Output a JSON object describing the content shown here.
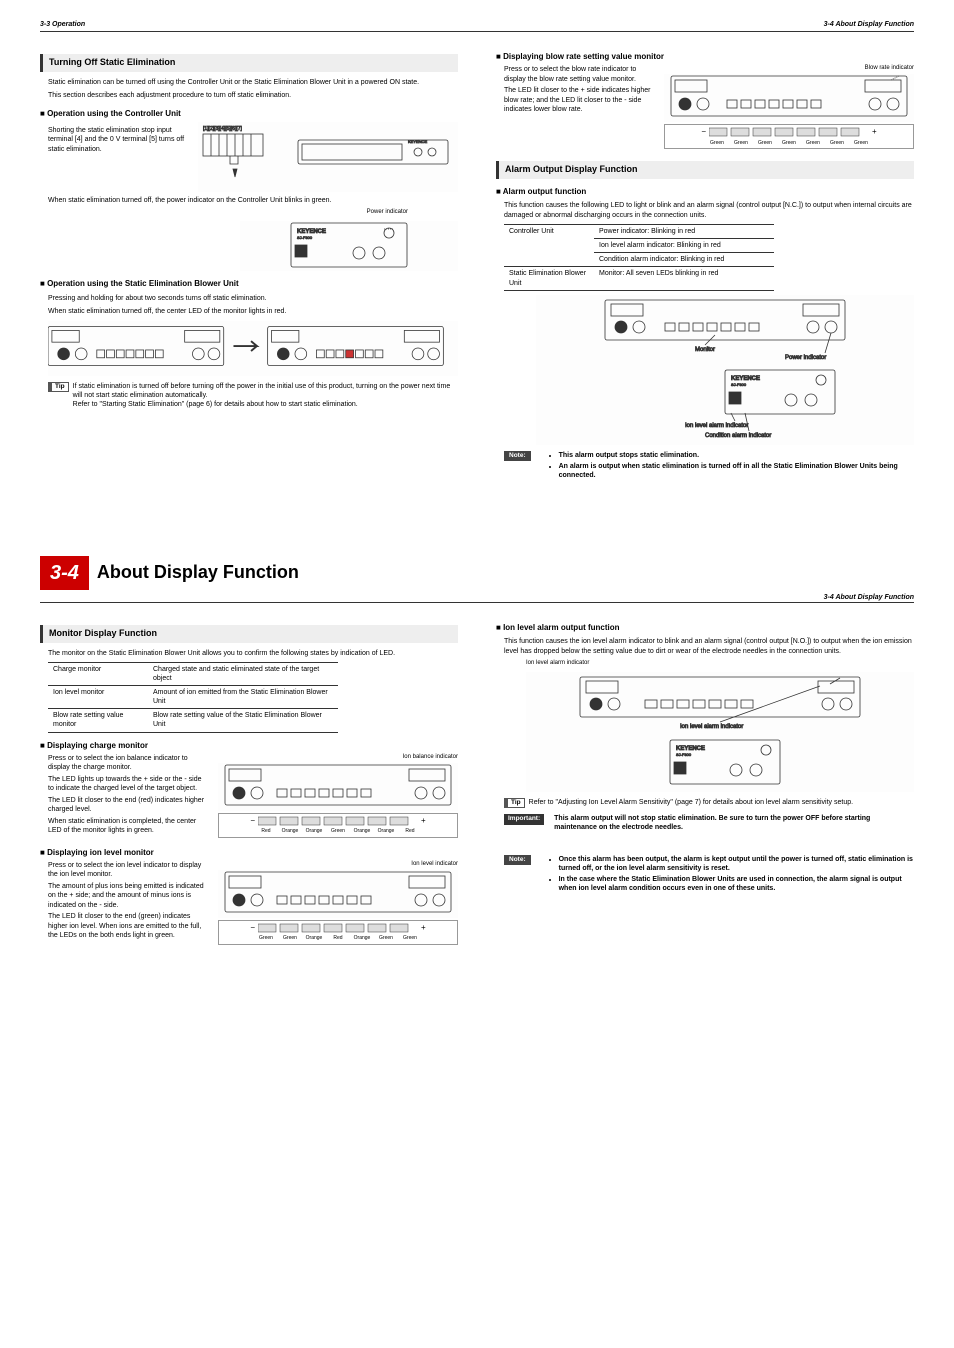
{
  "header": {
    "left": "3-3  Operation",
    "right": "3-4  About Display Function"
  },
  "left": {
    "sec1_title": "Turning Off Static Elimination",
    "sec1_p1": "Static elimination can be turned off using the Controller Unit or the Static Elimination Blower Unit in a powered ON state.",
    "sec1_p2": "This section describes each adjustment procedure to turn off static elimination.",
    "sub1": "Operation using the Controller Unit",
    "sub1_p1": "Shorting the static elimination stop input terminal [4] and the 0 V terminal [5] turns off static elimination.",
    "sub1_p2": "When static elimination turned off, the power indicator on the Controller Unit blinks in green.",
    "sub1_cap1": "Power indicator",
    "sub2": "Operation using the Static Elimination Blower Unit",
    "sub2_p1": "Pressing and holding       for about two seconds turns off static elimination.",
    "sub2_p2": "When static elimination turned off, the center LED of the monitor lights in red.",
    "tip1": "If static elimination is turned off before turning off the power in the initial use of this product, turning on the power next time will not start static elimination automatically.",
    "tip1_ref": "Refer to      \"Starting Static Elimination\" (page 6) for details about how to start static elimination."
  },
  "right": {
    "sub_blow": "Displaying blow rate setting value monitor",
    "blow_p1": "Press       or       to select the blow rate indicator to display the blow rate setting value monitor.",
    "blow_p2": "The LED lit closer to the + side indicates higher blow rate; and the LED lit closer to the - side indicates lower blow rate.",
    "blow_cap": "Blow rate indicator",
    "led_blow": [
      "Green",
      "Green",
      "Green",
      "Green",
      "Green",
      "Green",
      "Green"
    ],
    "sec2_title": "Alarm Output Display Function",
    "sub_alarm": "Alarm output function",
    "alarm_p1": "This function causes the following LED to light or blink and an alarm signal (control output [N.C.]) to output when internal circuits are damaged or abnormal discharging occurs in the connection units.",
    "table1": [
      [
        "Controller Unit",
        "Power indicator: Blinking in red"
      ],
      [
        "",
        "Ion level alarm indicator: Blinking in red"
      ],
      [
        "",
        "Condition alarm indicator: Blinking in red"
      ],
      [
        "Static Elimination Blower Unit",
        "Monitor: All seven LEDs blinking in red"
      ]
    ],
    "alarm_caps": {
      "mon": "Monitor",
      "pow": "Power indicator",
      "ion": "Ion level alarm indicator",
      "cond": "Condition alarm indicator"
    },
    "note1_b1": "This alarm output stops static elimination.",
    "note1_b2": "An alarm is output when static elimination is turned off in all the Static Elimination Blower Units being connected."
  },
  "ch": {
    "num": "3-4",
    "title": "About Display Function",
    "right": "3-4  About Display Function"
  },
  "left2": {
    "sec3_title": "Monitor Display Function",
    "sec3_p1": "The monitor on the Static Elimination Blower Unit allows you to confirm the following states by indication of LED.",
    "t2": [
      [
        "Charge monitor",
        "Charged state and static eliminated state of the target object"
      ],
      [
        "Ion level monitor",
        "Amount of ion emitted from the Static Elimination Blower Unit"
      ],
      [
        "Blow rate setting value monitor",
        "Blow rate setting value of the Static Elimination Blower Unit"
      ]
    ],
    "sub_charge": "Displaying charge monitor",
    "charge_p1": "Press       or       to select the ion balance indicator to display the charge monitor.",
    "charge_p2": "The LED lights up towards the + side or the - side to indicate the charged level of the target object.",
    "charge_p3": "The LED lit closer to the end (red) indicates higher charged level.",
    "charge_p4": "When static elimination is completed, the center LED of the monitor lights in green.",
    "charge_cap": "Ion balance indicator",
    "led_charge": [
      "Red",
      "Orange",
      "Orange",
      "Green",
      "Orange",
      "Orange",
      "Red"
    ],
    "sub_ion": "Displaying ion level monitor",
    "ion_p1": "Press       or       to select the ion level indicator to display the ion level monitor.",
    "ion_p2": "The amount of plus ions being emitted is indicated on the + side; and the amount of minus ions is indicated on the - side.",
    "ion_p3": "The LED lit closer to the end (green) indicates higher ion level. When ions are emitted to the full, the LEDs on the both ends light in green.",
    "ion_cap": "Ion level indicator",
    "led_ion": [
      "Green",
      "Green",
      "Orange",
      "Red",
      "Orange",
      "Green",
      "Green"
    ]
  },
  "right2": {
    "sub_ionalarm": "Ion level alarm output function",
    "ia_p1": "This function causes the ion level alarm indicator to blink and an alarm signal (control output [N.O.]) to output when the ion emission level has dropped below the setting value due to dirt or wear of the electrode needles in the connection units.",
    "ia_cap1": "Ion level alarm indicator",
    "ia_cap2": "Ion level alarm indicator",
    "tip2": "Refer to      \"Adjusting Ion Level Alarm Sensitivity\" (page 7) for details about ion level alarm sensitivity setup.",
    "imp": "This alarm output will not stop static elimination. Be sure to turn the power OFF before starting maintenance on the electrode needles.",
    "note2_b1": "Once this alarm has been output, the alarm is kept output until the power is turned off, static elimination is turned off, or the ion level alarm sensitivity is reset.",
    "note2_b2": "In the case where the Static Elimination Blower Units are used in connection, the alarm signal is output when ion level alarm condition occurs even in one of these units."
  }
}
